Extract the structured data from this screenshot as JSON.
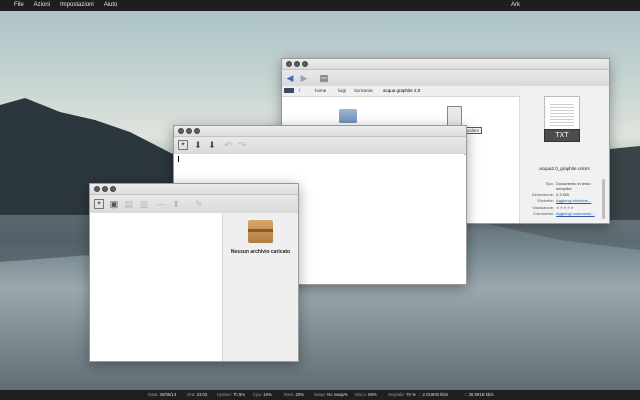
{
  "topbar": {
    "menus": [
      "File",
      "Azioni",
      "Impostazioni",
      "Aiuto"
    ],
    "app_name": "Ark"
  },
  "file_manager": {
    "breadcrumb": [
      "/",
      "home",
      "luigi",
      "Scrivania",
      "acqua graphite 2.0"
    ],
    "tooltip": "colors",
    "preview_type": "TXT",
    "file_name": "acqua2.0_graphite.colors",
    "props": [
      {
        "label": "Tipo:",
        "value": "Documento in testo semplice",
        "link": false
      },
      {
        "label": "Dimensione:",
        "value": "2,3 KiB",
        "link": false
      },
      {
        "label": "Etichette:",
        "value": "Aggiungi etichette...",
        "link": true
      },
      {
        "label": "Valutazione:",
        "value": "★★★★★",
        "link": false
      },
      {
        "label": "Commento:",
        "value": "Aggiungi commento...",
        "link": true
      }
    ]
  },
  "ark": {
    "empty_label": "Nessun archivio caricato"
  },
  "statusbar": {
    "items": [
      {
        "label": "Data:",
        "value": "25/05/13"
      },
      {
        "label": "Ora:",
        "value": "23:03"
      },
      {
        "label": "Uptime:",
        "value": "7h 8m"
      },
      {
        "label": "Cpu:",
        "value": "15%"
      },
      {
        "label": "Ram:",
        "value": "25%"
      },
      {
        "label": "Swap:",
        "value": "No swap%"
      },
      {
        "label": "Disco:",
        "value": "69%"
      },
      {
        "label": "Segnale:",
        "value": "70 %"
      },
      {
        "label": "↓:",
        "value": "2.019KB kb/s"
      },
      {
        "label": "↑:",
        "value": "36.991B kb/s"
      }
    ]
  }
}
